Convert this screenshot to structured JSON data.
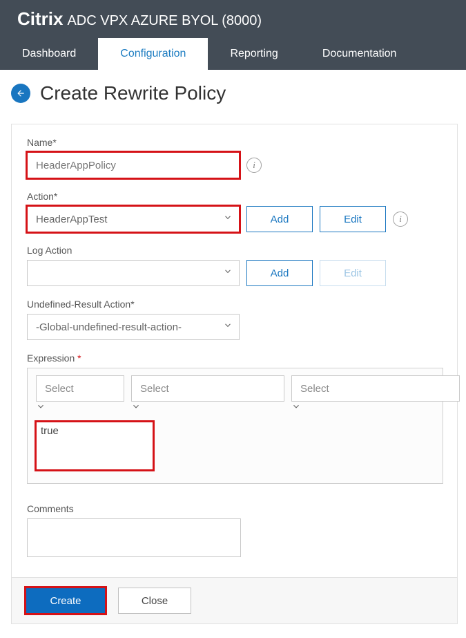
{
  "header": {
    "brand": "Citrix",
    "product": "ADC VPX AZURE BYOL (8000)"
  },
  "tabs": [
    "Dashboard",
    "Configuration",
    "Reporting",
    "Documentation"
  ],
  "active_tab": 1,
  "page_title": "Create Rewrite Policy",
  "fields": {
    "name": {
      "label": "Name*",
      "value": "HeaderAppPolicy"
    },
    "action": {
      "label": "Action*",
      "value": "HeaderAppTest",
      "add": "Add",
      "edit": "Edit"
    },
    "log_action": {
      "label": "Log Action",
      "value": "",
      "add": "Add",
      "edit": "Edit"
    },
    "undef": {
      "label": "Undefined-Result Action*",
      "value": "-Global-undefined-result-action-"
    },
    "expression": {
      "label": "Expression ",
      "selects": [
        "Select",
        "Select",
        "Select"
      ],
      "value": "true"
    },
    "comments": {
      "label": "Comments",
      "value": ""
    }
  },
  "footer": {
    "create": "Create",
    "close": "Close"
  }
}
